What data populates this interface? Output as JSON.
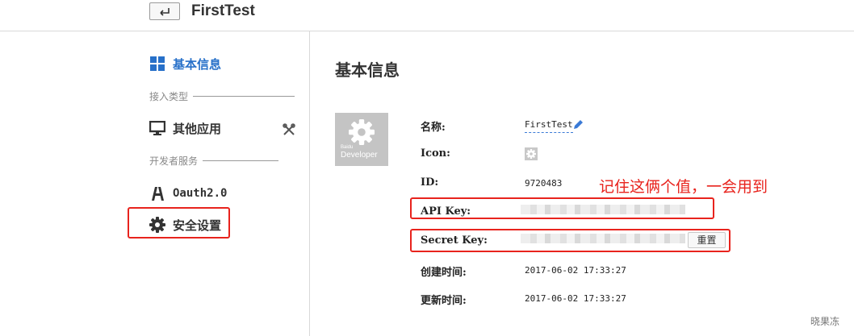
{
  "header": {
    "app_name": "FirstTest"
  },
  "sidebar": {
    "basic_info": "基本信息",
    "section_access_type": "接入类型",
    "other_apps": "其他应用",
    "section_dev_services": "开发者服务",
    "oauth": "Oauth2.0",
    "security_settings": "安全设置"
  },
  "main": {
    "title": "基本信息",
    "logo": {
      "brand": "Baidu",
      "text": "Developer"
    },
    "fields": {
      "name_label": "名称:",
      "name_value": "FirstTest",
      "icon_label": "Icon:",
      "id_label": "ID:",
      "id_value": "9720483",
      "api_key_label": "API Key:",
      "secret_key_label": "Secret Key:",
      "created_label": "创建时间:",
      "created_value": "2017-06-02 17:33:27",
      "updated_label": "更新时间:",
      "updated_value": "2017-06-02 17:33:27"
    },
    "reset_label": "重置"
  },
  "annotation": {
    "text": "记住这俩个值，一会用到"
  },
  "watermark": "晓果冻",
  "colors": {
    "accent": "#2770c9",
    "highlight": "#e8231d"
  },
  "icons": [
    "back-arrow-icon",
    "grid-icon",
    "monitor-icon",
    "tools-icon",
    "oauth-icon",
    "gear-icon",
    "pencil-icon"
  ]
}
